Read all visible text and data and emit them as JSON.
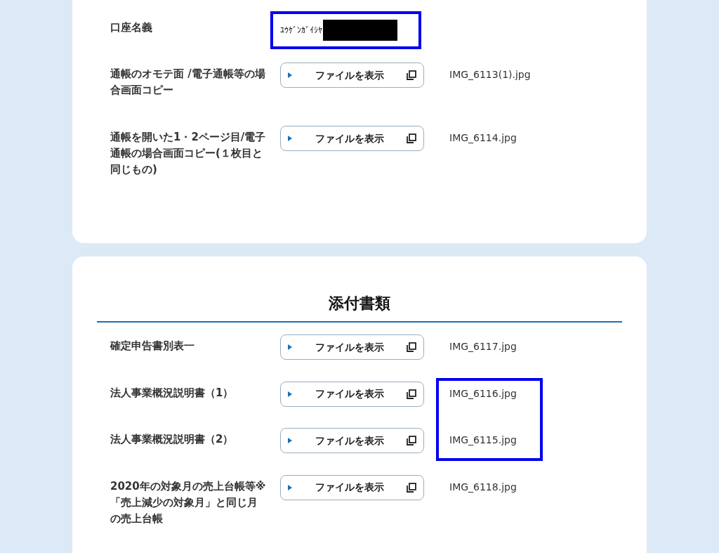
{
  "account_section": {
    "rows": [
      {
        "kind": "text",
        "label": "口座名義",
        "value": "ﾕｳｹﾞﾝｶﾞｲｼﾔ",
        "redacted": true
      },
      {
        "kind": "file",
        "label": "通帳のオモテ面 /電子通帳等の場合画面コピー",
        "button": "ファイルを表示",
        "filename": "IMG_6113(1).jpg"
      },
      {
        "kind": "file",
        "label": "通帳を開いた1・2ページ目/電子通帳の場合画面コピー(１枚目と同じもの)",
        "button": "ファイルを表示",
        "filename": "IMG_6114.jpg"
      }
    ]
  },
  "attachments": {
    "title": "添付書類",
    "rows": [
      {
        "kind": "file",
        "label": "確定申告書別表一",
        "button": "ファイルを表示",
        "filename": "IMG_6117.jpg"
      },
      {
        "kind": "file",
        "label": "法人事業概況説明書（1）",
        "button": "ファイルを表示",
        "filename": "IMG_6116.jpg"
      },
      {
        "kind": "file",
        "label": "法人事業概況説明書（2）",
        "button": "ファイルを表示",
        "filename": "IMG_6115.jpg"
      },
      {
        "kind": "file",
        "label": "2020年の対象月の売上台帳等※「売上減少の対象月」と同じ月の売上台帳",
        "button": "ファイルを表示",
        "filename": "IMG_6118.jpg"
      }
    ]
  }
}
